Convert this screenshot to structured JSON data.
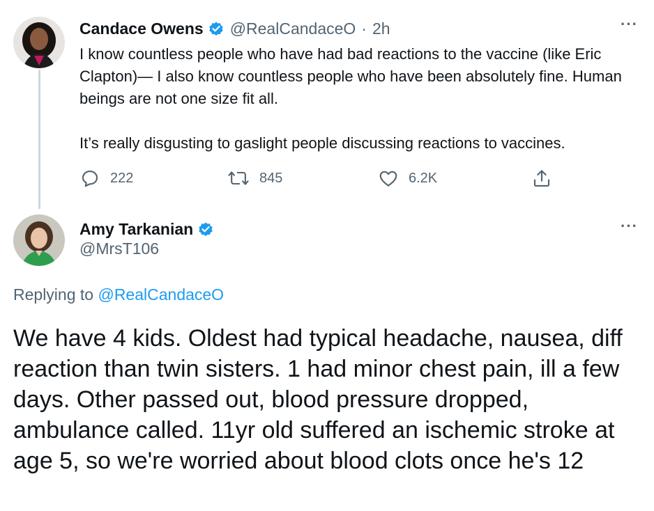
{
  "tweet1": {
    "author_name": "Candace Owens",
    "handle": "@RealCandaceO",
    "separator": "·",
    "time": "2h",
    "text_p1": "I know countless people who have had bad reactions to the vaccine (like Eric Clapton)— I also know countless people who have been absolutely fine. Human beings are not one size fit all.",
    "text_p2": "It’s really disgusting to gaslight people discussing reactions to vaccines.",
    "replies": "222",
    "retweets": "845",
    "likes": "6.2K",
    "more_label": "···"
  },
  "tweet2": {
    "author_name": "Amy Tarkanian",
    "handle": "@MrsT106",
    "replying_prefix": "Replying to",
    "replying_to": "@RealCandaceO",
    "text": "We have 4 kids. Oldest had typical headache, nausea, diff reaction than twin sisters. 1 had minor chest pain, ill a few days. Other passed out, blood pressure dropped, ambulance called. 11yr old suffered an ischemic stroke at age 5, so we're worried about blood clots once he's 12",
    "more_label": "···"
  },
  "icons": {
    "reply": "reply-icon",
    "retweet": "retweet-icon",
    "like": "like-icon",
    "share": "share-icon",
    "verified": "verified-badge-icon"
  },
  "colors": {
    "text": "#0f1419",
    "secondary": "#536471",
    "link": "#1d9bf0",
    "thread_line": "#cfd9de"
  }
}
